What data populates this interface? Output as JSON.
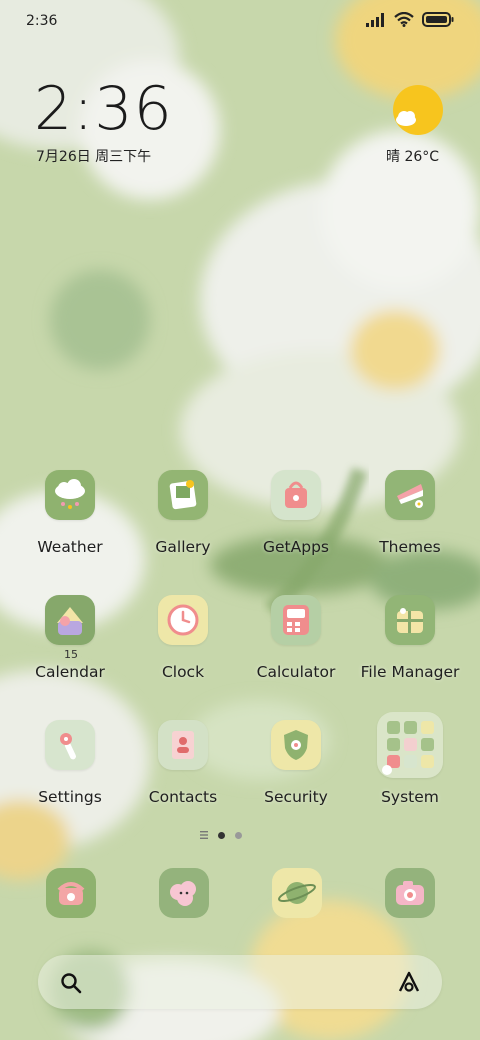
{
  "status_bar": {
    "time": "2:36"
  },
  "widget": {
    "clock": "2:36",
    "date": "7月26日 周三下午",
    "weather": "晴 26°C"
  },
  "apps": [
    {
      "label": "Weather",
      "icon": "weather-icon"
    },
    {
      "label": "Gallery",
      "icon": "gallery-icon"
    },
    {
      "label": "GetApps",
      "icon": "getapps-icon"
    },
    {
      "label": "Themes",
      "icon": "themes-icon"
    },
    {
      "label": "Calendar",
      "icon": "calendar-icon",
      "badge": "15"
    },
    {
      "label": "Clock",
      "icon": "clock-icon"
    },
    {
      "label": "Calculator",
      "icon": "calculator-icon"
    },
    {
      "label": "File Manager",
      "icon": "file-manager-icon"
    },
    {
      "label": "Settings",
      "icon": "settings-icon"
    },
    {
      "label": "Contacts",
      "icon": "contacts-icon"
    },
    {
      "label": "Security",
      "icon": "security-icon"
    },
    {
      "label": "System",
      "icon": "system-folder-icon"
    }
  ],
  "page_indicator": {
    "pages": 2,
    "current": 1
  },
  "dock": [
    {
      "icon": "phone-icon"
    },
    {
      "icon": "messages-icon"
    },
    {
      "icon": "browser-icon"
    },
    {
      "icon": "camera-icon"
    }
  ],
  "colors": {
    "wallpaper_green": "#c9d9ae",
    "icon_green": "#9dbb7f",
    "accent_yellow": "#f7c51e"
  }
}
